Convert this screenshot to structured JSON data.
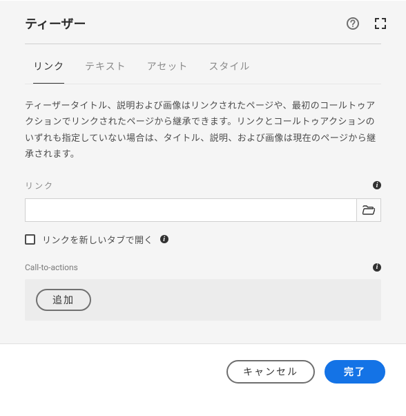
{
  "header": {
    "title": "ティーザー"
  },
  "tabs": [
    {
      "label": "リンク",
      "active": true
    },
    {
      "label": "テキスト",
      "active": false
    },
    {
      "label": "アセット",
      "active": false
    },
    {
      "label": "スタイル",
      "active": false
    }
  ],
  "panel": {
    "description": "ティーザータイトル、説明および画像はリンクされたページや、最初のコールトゥアクションでリンクされたページから継承できます。リンクとコールトゥアクションのいずれも指定していない場合は、タイトル、説明、および画像は現在のページから継承されます。",
    "link_field": {
      "label": "リンク",
      "value": "",
      "placeholder": ""
    },
    "open_new_tab": {
      "label": "リンクを新しいタブで開く",
      "checked": false
    },
    "cta": {
      "label": "Call-to-actions",
      "add_label": "追加"
    }
  },
  "footer": {
    "cancel": "キャンセル",
    "done": "完了"
  },
  "info_glyph": "i"
}
